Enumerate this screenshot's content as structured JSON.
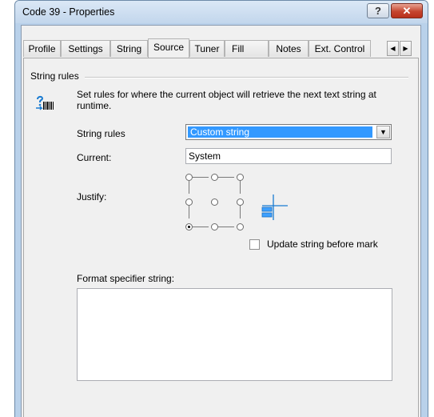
{
  "window": {
    "title": "Code 39 - Properties",
    "help_label": "?",
    "close_label": "✕"
  },
  "tabs": [
    {
      "label": "Profile"
    },
    {
      "label": "Settings"
    },
    {
      "label": "String"
    },
    {
      "label": "Source",
      "active": true
    },
    {
      "label": "Tuner"
    },
    {
      "label": "Fill"
    },
    {
      "label": "Notes"
    },
    {
      "label": "Ext. Control"
    }
  ],
  "tab_scroll": {
    "left": "◀",
    "right": "▶"
  },
  "group": {
    "title": "String rules",
    "description": "Set rules for where the current object will retrieve the next text string at runtime.",
    "icon": "barcode-string-icon"
  },
  "form": {
    "string_rules_label": "String rules",
    "string_rules_value": "Custom string",
    "current_label": "Current:",
    "current_value": "System",
    "justify_label": "Justify:",
    "justify_selected": "bottom-left",
    "update_label": "Update string before mark",
    "update_checked": false,
    "format_label": "Format specifier string:",
    "format_value": ""
  },
  "colors": {
    "selection": "#3399ff",
    "close": "#c5452f",
    "accent_icon": "#1a7bd1"
  }
}
